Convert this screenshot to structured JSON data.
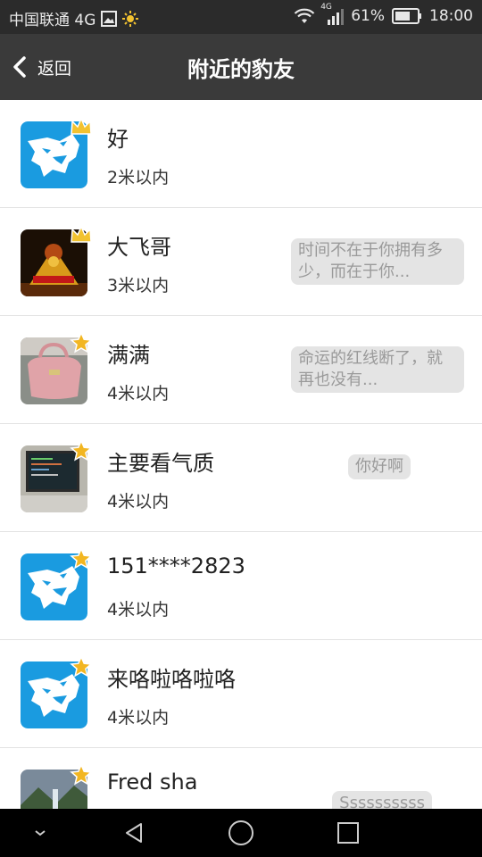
{
  "status_bar": {
    "carrier": "中国联通 4G",
    "network_type": "4G",
    "battery": "61%",
    "time": "18:00"
  },
  "nav": {
    "back_label": "返回",
    "title": "附近的豹友"
  },
  "users": [
    {
      "name": "好",
      "distance": "2米以内",
      "signature": "",
      "badge": "crown",
      "avatar": "leopard"
    },
    {
      "name": "大飞哥",
      "distance": "3米以内",
      "signature": "时间不在于你拥有多少，而在于你...",
      "badge": "crown",
      "avatar": "photo-figure"
    },
    {
      "name": "满满",
      "distance": "4米以内",
      "signature": "命运的红线断了，就再也没有...",
      "badge": "star",
      "avatar": "photo-bag"
    },
    {
      "name": "主要看气质",
      "distance": "4米以内",
      "signature": "你好啊",
      "badge": "star",
      "avatar": "photo-laptop"
    },
    {
      "name": "151****2823",
      "distance": "4米以内",
      "signature": "",
      "badge": "star",
      "avatar": "leopard"
    },
    {
      "name": "来咯啦咯啦咯",
      "distance": "4米以内",
      "signature": "",
      "badge": "star",
      "avatar": "leopard"
    },
    {
      "name": "Fred sha",
      "distance": "",
      "signature": "Ssssssssss",
      "badge": "star",
      "avatar": "photo-waterfall"
    }
  ],
  "colors": {
    "status_bar_bg": "#2b2b2b",
    "nav_bg": "#3a3a3a",
    "leopard_blue": "#1a9be0",
    "crown_gold": "#f2c230",
    "signature_bg": "#e4e4e4"
  }
}
